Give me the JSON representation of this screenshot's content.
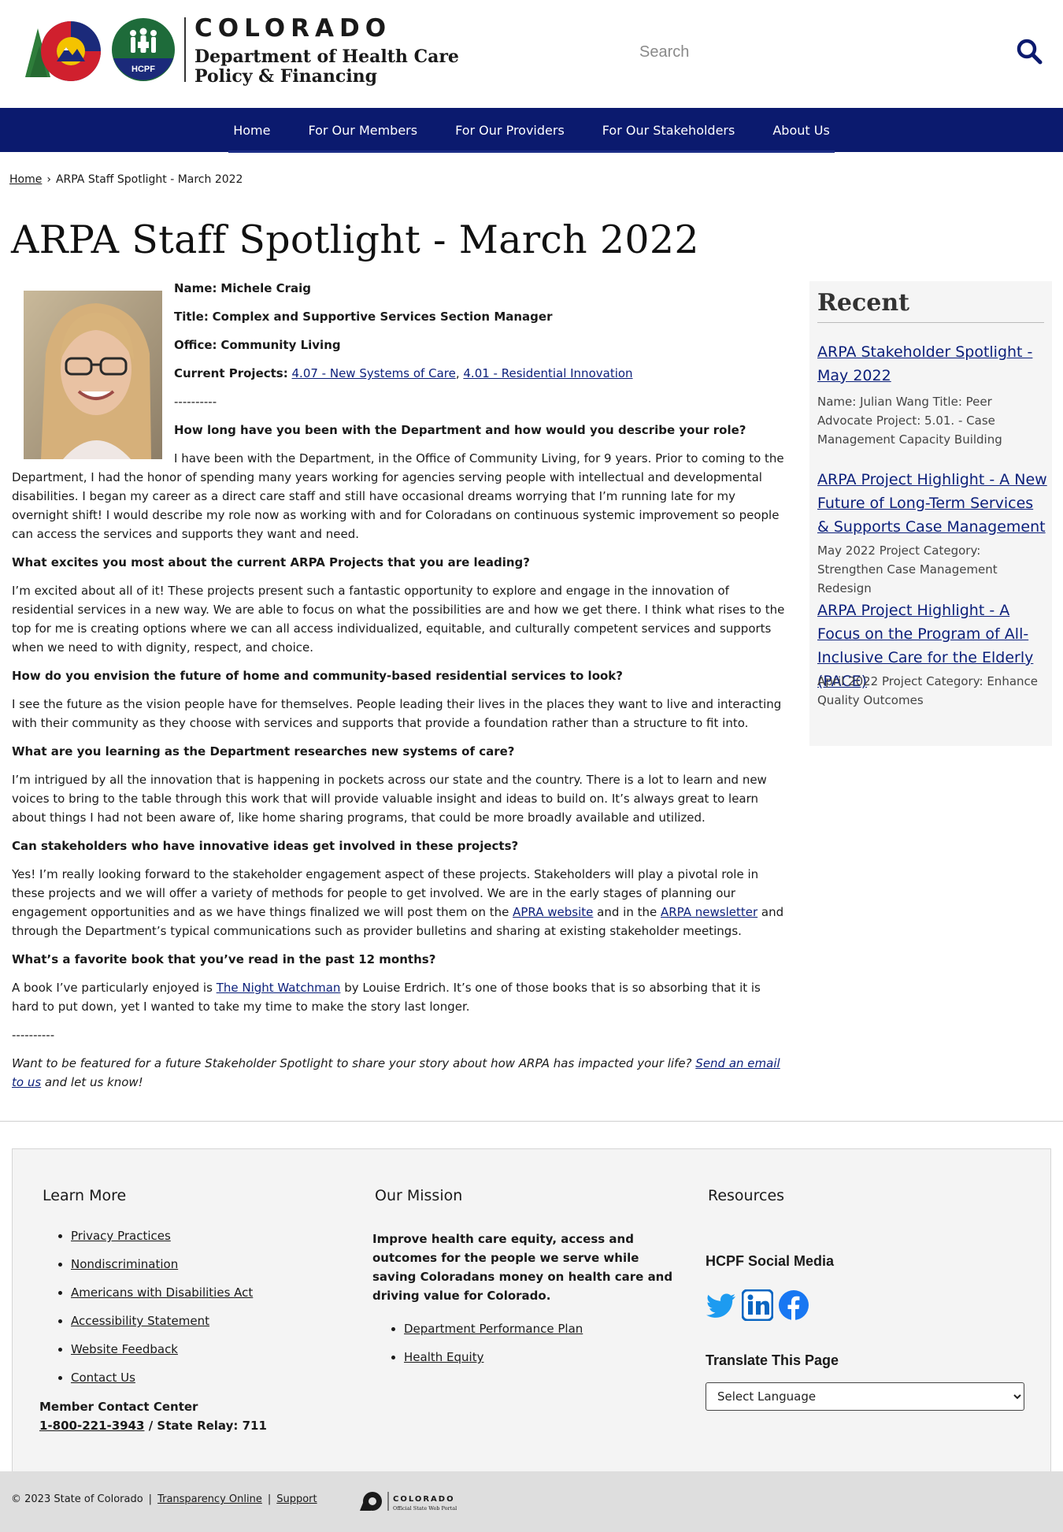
{
  "header": {
    "state_name": "COLORADO",
    "dept_line1": "Department of Health Care",
    "dept_line2": "Policy & Financing",
    "hcpf_badge": "HCPF",
    "search_placeholder": "Search"
  },
  "nav": {
    "items": [
      "Home",
      "For Our Members",
      "For Our Providers",
      "For Our Stakeholders",
      "About Us"
    ]
  },
  "breadcrumb": {
    "home": "Home",
    "separator": "›",
    "current": "ARPA Staff Spotlight - March 2022"
  },
  "page_title": "ARPA Staff Spotlight - March 2022",
  "profile": {
    "name_label": "Name:",
    "name": "Michele Craig",
    "title_label": "Title:",
    "title": "Complex and Supportive Services Section Manager",
    "office_label": "Office:",
    "office": "Community Living",
    "projects_label": "Current Projects:",
    "project1": "4.07 - New Systems of Care",
    "project_sep": ",",
    "project2": "4.01 - Residential Innovation",
    "divider": "----------"
  },
  "article": {
    "q1": "How long have you been with the Department and how would you describe your role?",
    "a1": "I have been with the Department, in the Office of Community Living, for 9 years. Prior to coming to the Department, I had the honor of spending many years working for agencies serving people with intellectual and developmental disabilities. I began my career as a direct care staff and still have occasional dreams worrying that I’m running late for my overnight shift! I would describe my role now as working with and for Coloradans on continuous systemic improvement so people can access the services and supports they want and need.",
    "q2": "What excites you most about the current ARPA Projects that you are leading?",
    "a2": "I’m excited about all of it! These projects present such a fantastic opportunity to explore and engage in the innovation of residential services in a new way. We are able to focus on what the possibilities are and how we get there. I think what rises to the top for me is creating options where we can all access individualized, equitable, and culturally competent services and supports when we need to with dignity, respect, and choice.",
    "q3": "How do you envision the future of home and community-based residential services to look?",
    "a3": "I see the future as the vision people have for themselves. People leading their lives in the places they want to live and interacting with their community as they choose with services and supports that provide a foundation rather than a structure to fit into.",
    "q4": "What are you learning as the Department researches new systems of care?",
    "a4": "I’m intrigued by all the innovation that is happening in pockets across our state and the country. There is a lot to learn and new voices to bring to the table through this work that will provide valuable insight and ideas to build on. It’s always great to learn about things I had not been aware of, like home sharing programs, that could be more broadly available and utilized.",
    "q5": "Can stakeholders who have innovative ideas get involved in these projects?",
    "a5_part1": "Yes! I’m really looking forward to the stakeholder engagement aspect of these projects. Stakeholders will play a pivotal role in these projects and we will offer a variety of methods for people to get involved. We are in the early stages of planning our engagement opportunities and as we have things finalized we will post them on the ",
    "a5_link1": "APRA website",
    "a5_part2": " and in the ",
    "a5_link2": "ARPA newsletter",
    "a5_part3": " and through the Department’s typical communications such as provider bulletins and sharing at existing stakeholder meetings.",
    "q6": "What’s a favorite book that you’ve read in the past 12 months?",
    "a6_part1": "A book I’ve particularly enjoyed is ",
    "a6_link": "The Night Watchman",
    "a6_part2": " by Louise Erdrich. It’s one of those books that is so absorbing that it is hard to put down, yet I wanted to take my time to make the story last longer.",
    "divider": "----------",
    "cta_part1": "Want to be featured for a future Stakeholder Spotlight to share your story about how ARPA has impacted your life? ",
    "cta_link": "Send an email to us",
    "cta_part2": " and let us know!"
  },
  "sidebar": {
    "heading": "Recent",
    "items": [
      {
        "title": "ARPA Stakeholder Spotlight - May 2022",
        "desc": "Name: Julian Wang   Title: Peer Advocate   Project: 5.01. - Case Management Capacity Building"
      },
      {
        "title": "ARPA Project Highlight - A New Future of Long-Term Services & Supports Case Management",
        "desc": "May 2022 Project Category: Strengthen Case Management Redesign"
      },
      {
        "title": "ARPA Project Highlight - A Focus on the Program of All-Inclusive Care for the Elderly (PACE)",
        "desc": "April 2022 Project Category: Enhance Quality Outcomes"
      }
    ]
  },
  "footer": {
    "learn_more": {
      "heading": "Learn More",
      "links": [
        "Privacy Practices",
        "Nondiscrimination",
        "Americans with Disabilities Act",
        "Accessibility Statement",
        "Website Feedback",
        "Contact Us"
      ]
    },
    "contact": {
      "label": "Member Contact Center",
      "phone": "1-800-221-3943",
      "relay": " / State Relay: 711"
    },
    "mission": {
      "heading": "Our Mission",
      "text": "Improve health care equity, access and outcomes for the people we serve while saving Coloradans money on health care and driving value for Colorado.",
      "links": [
        "Department Performance Plan",
        "Health Equity"
      ]
    },
    "resources": {
      "heading": "Resources",
      "social_heading": "HCPF Social Media",
      "translate_heading": "Translate This Page",
      "language_selected": "Select Language"
    }
  },
  "bottom": {
    "copyright": "© 2023 State of Colorado",
    "sep": "|",
    "transparency": "Transparency Online",
    "support": "Support",
    "portal_name": "COLORADO",
    "portal_sub": "Official State Web Portal"
  },
  "colors": {
    "nav_bg": "#0b1a6e",
    "link": "#0b1f7a",
    "hcpf_green": "#1e6b3a",
    "co_red": "#d0202e",
    "co_yellow": "#f4c300",
    "co_blue": "#1b2a7a",
    "tree_green": "#2e7d3a"
  }
}
